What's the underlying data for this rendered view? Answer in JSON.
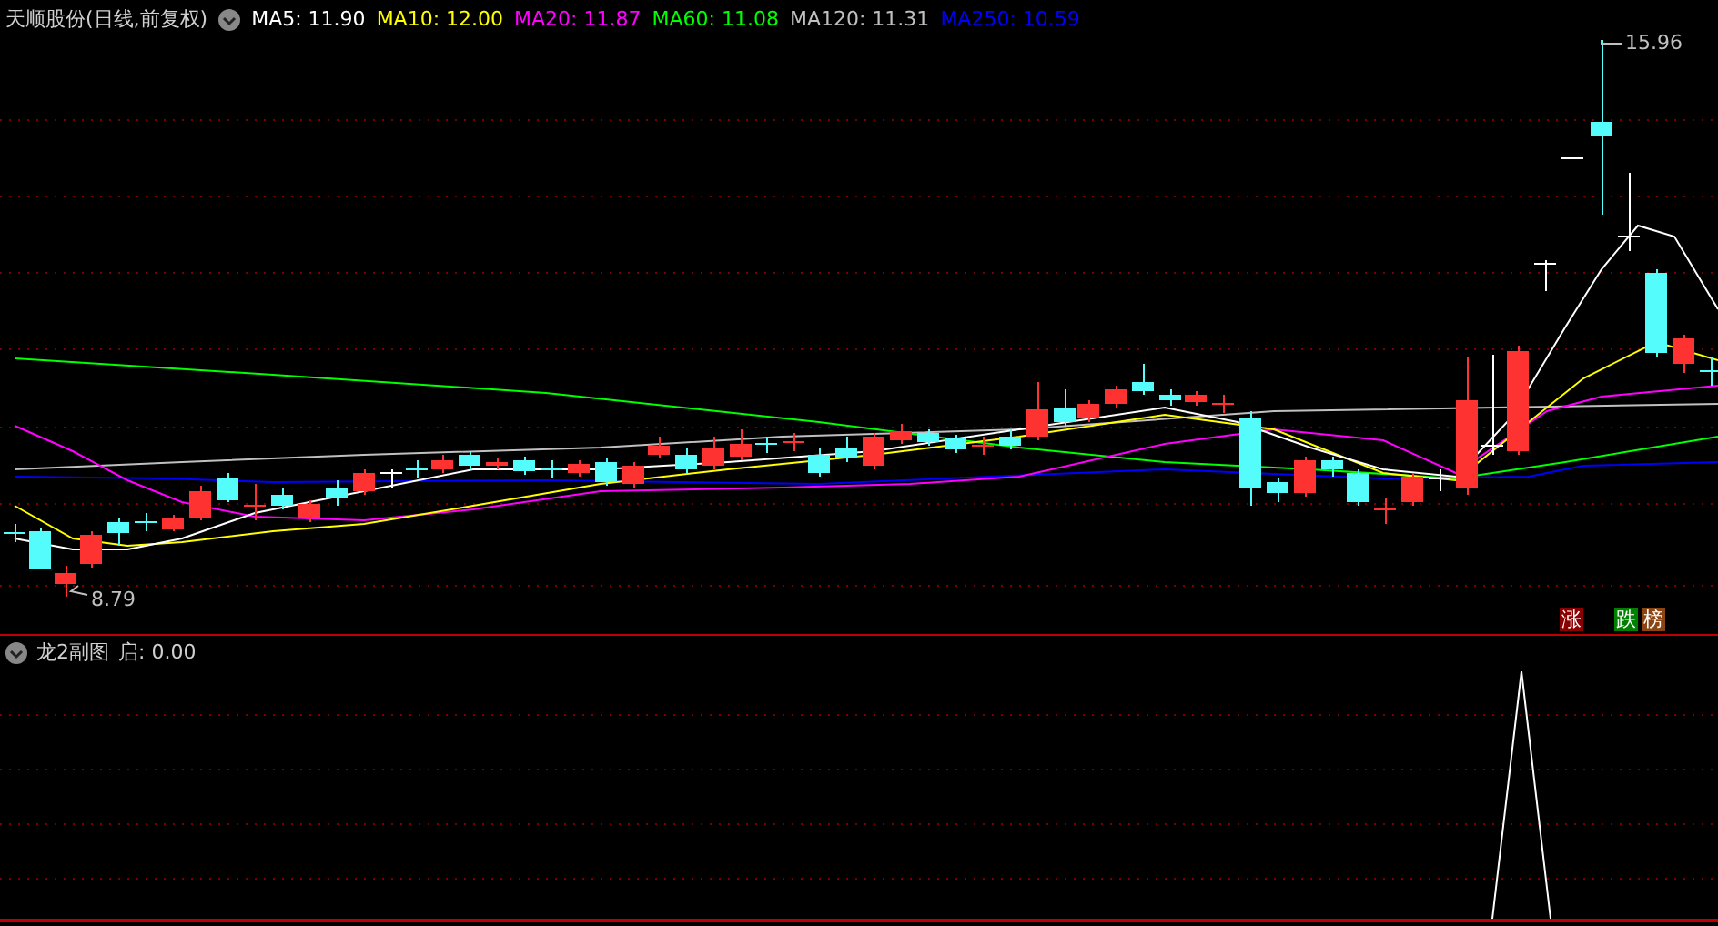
{
  "main_chart": {
    "title": "天顺股份(日线,前复权)",
    "indicators": [
      {
        "label": "MA5: 11.90",
        "color": "#ffffff"
      },
      {
        "label": "MA10: 12.00",
        "color": "#ffff00"
      },
      {
        "label": "MA20: 11.87",
        "color": "#ff00ff"
      },
      {
        "label": "MA60: 11.08",
        "color": "#00ff00"
      },
      {
        "label": "MA120: 11.31",
        "color": "#c0c0c0"
      },
      {
        "label": "MA250: 10.59",
        "color": "#0000ff"
      }
    ],
    "high_label": "15.96",
    "low_label": "8.79",
    "badges": [
      {
        "text": "涨",
        "color": "#8b0000"
      },
      {
        "text": "跌",
        "color": "#008000"
      },
      {
        "text": "榜",
        "color": "#8b4513"
      }
    ]
  },
  "sub_chart": {
    "title": "龙2副图",
    "indicators": [
      {
        "label": "启: 0.00"
      }
    ]
  }
}
